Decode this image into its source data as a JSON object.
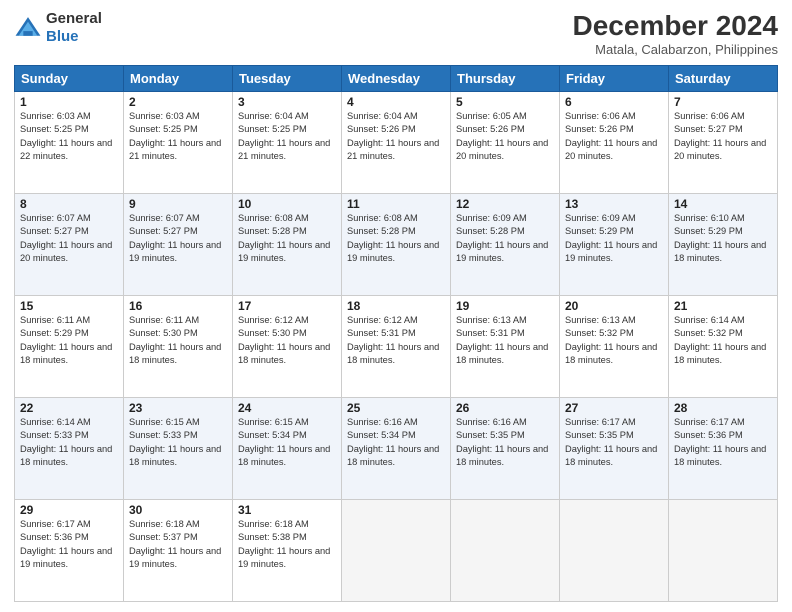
{
  "header": {
    "logo_general": "General",
    "logo_blue": "Blue",
    "month_title": "December 2024",
    "location": "Matala, Calabarzon, Philippines"
  },
  "days_of_week": [
    "Sunday",
    "Monday",
    "Tuesday",
    "Wednesday",
    "Thursday",
    "Friday",
    "Saturday"
  ],
  "weeks": [
    [
      {
        "day": 1,
        "sunrise": "6:03 AM",
        "sunset": "5:25 PM",
        "daylight": "11 hours and 22 minutes."
      },
      {
        "day": 2,
        "sunrise": "6:03 AM",
        "sunset": "5:25 PM",
        "daylight": "11 hours and 21 minutes."
      },
      {
        "day": 3,
        "sunrise": "6:04 AM",
        "sunset": "5:25 PM",
        "daylight": "11 hours and 21 minutes."
      },
      {
        "day": 4,
        "sunrise": "6:04 AM",
        "sunset": "5:26 PM",
        "daylight": "11 hours and 21 minutes."
      },
      {
        "day": 5,
        "sunrise": "6:05 AM",
        "sunset": "5:26 PM",
        "daylight": "11 hours and 20 minutes."
      },
      {
        "day": 6,
        "sunrise": "6:06 AM",
        "sunset": "5:26 PM",
        "daylight": "11 hours and 20 minutes."
      },
      {
        "day": 7,
        "sunrise": "6:06 AM",
        "sunset": "5:27 PM",
        "daylight": "11 hours and 20 minutes."
      }
    ],
    [
      {
        "day": 8,
        "sunrise": "6:07 AM",
        "sunset": "5:27 PM",
        "daylight": "11 hours and 20 minutes."
      },
      {
        "day": 9,
        "sunrise": "6:07 AM",
        "sunset": "5:27 PM",
        "daylight": "11 hours and 19 minutes."
      },
      {
        "day": 10,
        "sunrise": "6:08 AM",
        "sunset": "5:28 PM",
        "daylight": "11 hours and 19 minutes."
      },
      {
        "day": 11,
        "sunrise": "6:08 AM",
        "sunset": "5:28 PM",
        "daylight": "11 hours and 19 minutes."
      },
      {
        "day": 12,
        "sunrise": "6:09 AM",
        "sunset": "5:28 PM",
        "daylight": "11 hours and 19 minutes."
      },
      {
        "day": 13,
        "sunrise": "6:09 AM",
        "sunset": "5:29 PM",
        "daylight": "11 hours and 19 minutes."
      },
      {
        "day": 14,
        "sunrise": "6:10 AM",
        "sunset": "5:29 PM",
        "daylight": "11 hours and 18 minutes."
      }
    ],
    [
      {
        "day": 15,
        "sunrise": "6:11 AM",
        "sunset": "5:29 PM",
        "daylight": "11 hours and 18 minutes."
      },
      {
        "day": 16,
        "sunrise": "6:11 AM",
        "sunset": "5:30 PM",
        "daylight": "11 hours and 18 minutes."
      },
      {
        "day": 17,
        "sunrise": "6:12 AM",
        "sunset": "5:30 PM",
        "daylight": "11 hours and 18 minutes."
      },
      {
        "day": 18,
        "sunrise": "6:12 AM",
        "sunset": "5:31 PM",
        "daylight": "11 hours and 18 minutes."
      },
      {
        "day": 19,
        "sunrise": "6:13 AM",
        "sunset": "5:31 PM",
        "daylight": "11 hours and 18 minutes."
      },
      {
        "day": 20,
        "sunrise": "6:13 AM",
        "sunset": "5:32 PM",
        "daylight": "11 hours and 18 minutes."
      },
      {
        "day": 21,
        "sunrise": "6:14 AM",
        "sunset": "5:32 PM",
        "daylight": "11 hours and 18 minutes."
      }
    ],
    [
      {
        "day": 22,
        "sunrise": "6:14 AM",
        "sunset": "5:33 PM",
        "daylight": "11 hours and 18 minutes."
      },
      {
        "day": 23,
        "sunrise": "6:15 AM",
        "sunset": "5:33 PM",
        "daylight": "11 hours and 18 minutes."
      },
      {
        "day": 24,
        "sunrise": "6:15 AM",
        "sunset": "5:34 PM",
        "daylight": "11 hours and 18 minutes."
      },
      {
        "day": 25,
        "sunrise": "6:16 AM",
        "sunset": "5:34 PM",
        "daylight": "11 hours and 18 minutes."
      },
      {
        "day": 26,
        "sunrise": "6:16 AM",
        "sunset": "5:35 PM",
        "daylight": "11 hours and 18 minutes."
      },
      {
        "day": 27,
        "sunrise": "6:17 AM",
        "sunset": "5:35 PM",
        "daylight": "11 hours and 18 minutes."
      },
      {
        "day": 28,
        "sunrise": "6:17 AM",
        "sunset": "5:36 PM",
        "daylight": "11 hours and 18 minutes."
      }
    ],
    [
      {
        "day": 29,
        "sunrise": "6:17 AM",
        "sunset": "5:36 PM",
        "daylight": "11 hours and 19 minutes."
      },
      {
        "day": 30,
        "sunrise": "6:18 AM",
        "sunset": "5:37 PM",
        "daylight": "11 hours and 19 minutes."
      },
      {
        "day": 31,
        "sunrise": "6:18 AM",
        "sunset": "5:38 PM",
        "daylight": "11 hours and 19 minutes."
      },
      null,
      null,
      null,
      null
    ]
  ]
}
